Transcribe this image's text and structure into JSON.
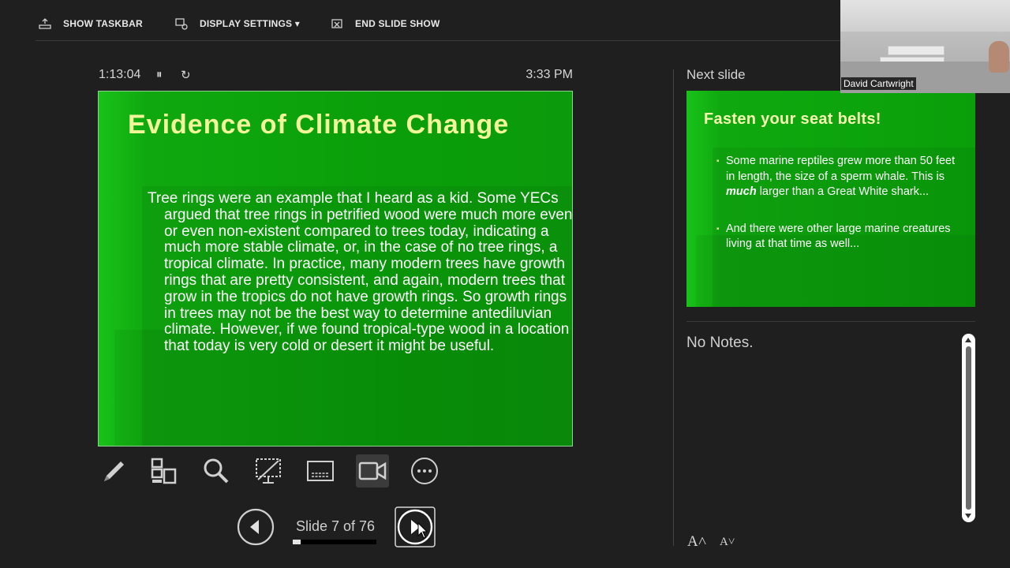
{
  "toolbar": {
    "show_taskbar": "SHOW TASKBAR",
    "display_settings": "DISPLAY SETTINGS ▾",
    "end_slide_show": "END SLIDE SHOW"
  },
  "timer": {
    "elapsed": "1:13:04",
    "pause_glyph": "⏸",
    "reset_glyph": "↻",
    "clock": "3:33 PM"
  },
  "current_slide": {
    "title": "Evidence of Climate Change",
    "body": "Tree rings were an example that I heard as a kid. Some YECs argued that tree rings in petrified wood were much more even or even non-existent compared to trees today, indicating a much more stable climate, or, in the case of no tree rings, a tropical climate. In practice, many modern trees have growth rings that are pretty consistent, and again, modern trees that grow in the tropics do not have growth rings. So growth rings in trees may not be the best way to determine antediluvian climate. However, if we found tropical-type wood in a location that today is very cold or desert it might be useful."
  },
  "tools": [
    "pen-icon",
    "slides-grid-icon",
    "zoom-icon",
    "black-screen-icon",
    "subtitles-icon",
    "camera-icon",
    "more-options-icon"
  ],
  "navigation": {
    "counter": "Slide 7 of 76",
    "current": 7,
    "total": 76
  },
  "next_slide": {
    "label": "Next slide",
    "title": "Fasten your seat belts!",
    "bullet1_pre": "Some marine reptiles grew more than 50 feet in length, the size of a sperm whale. This is ",
    "bullet1_em": "much",
    "bullet1_post": " larger than a Great White shark...",
    "bullet2": "And there were other large marine creatures living at that time as well..."
  },
  "notes": {
    "text": "No Notes.",
    "increase_font": "A˄",
    "decrease_font": "A˅"
  },
  "webcam": {
    "name": "David Cartwright"
  },
  "colors": {
    "slide_green": "#0a9f0a",
    "title_yellow": "#f3f59a",
    "background": "#1f1f1f"
  }
}
